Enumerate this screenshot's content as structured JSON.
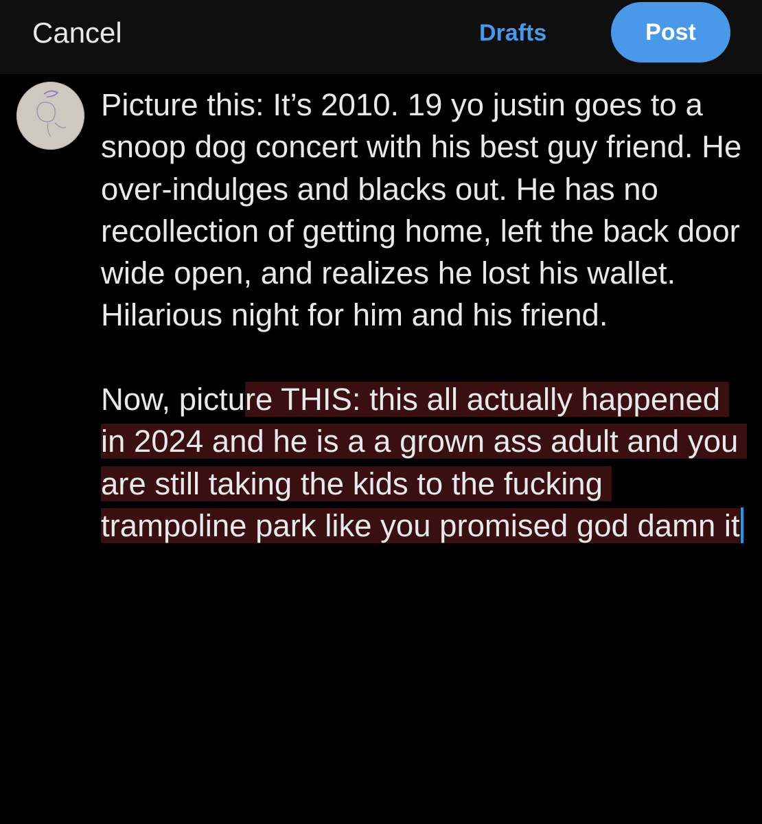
{
  "header": {
    "cancel_label": "Cancel",
    "drafts_label": "Drafts",
    "post_label": "Post"
  },
  "colors": {
    "accent": "#4a99e9",
    "background": "#000000",
    "topbar": "#0f0f0f",
    "selection": "#3a0f12",
    "caret": "#1d9bf0",
    "text": "#e7e9ea"
  },
  "avatar": {
    "icon": "doodle-avatar-icon"
  },
  "compose": {
    "paragraph_1": "Picture this: It’s 2010. 19 yo justin goes to a snoop dog concert with his best guy friend. He over-indulges and blacks out. He has no recollection of getting home, left the back door wide open, and realizes he lost his wallet. Hilarious night for him and his friend.",
    "paragraph_2_unselected": "Now, pictu",
    "paragraph_2_selected": "re THIS: this all actually happened in 2024 and he is a a grown ass adult and you are still taking the kids to the fucking trampoline park like you promised god damn it"
  }
}
